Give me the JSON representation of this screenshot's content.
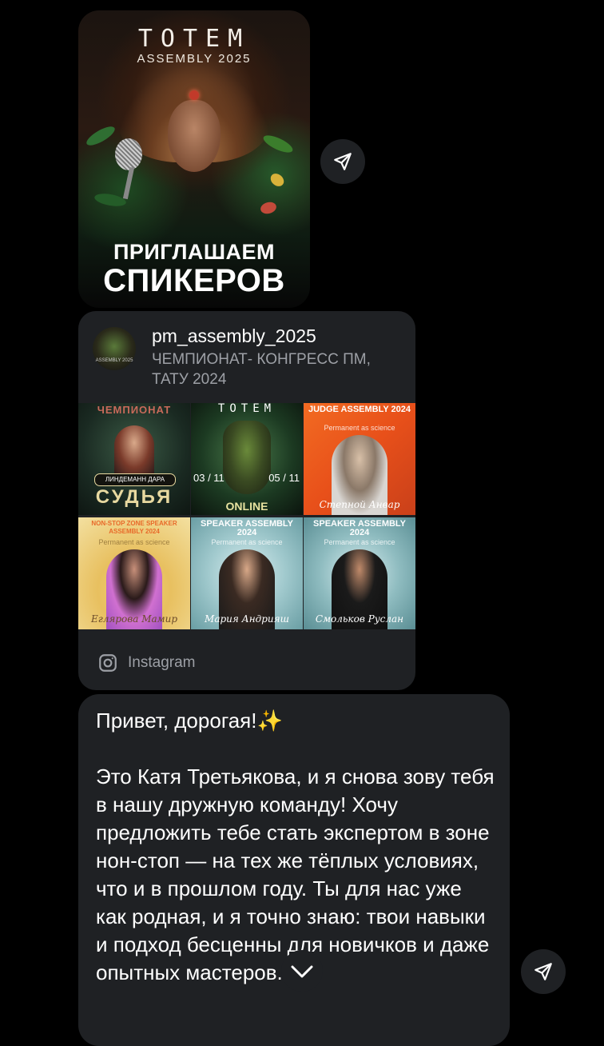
{
  "story_poster": {
    "brand": "TOTEM",
    "subtitle": "ASSEMBLY 2025",
    "cta_line1": "ПРИГЛАШАЕМ",
    "cta_line2": "СПИКЕРОВ"
  },
  "instagram_card": {
    "username": "pm_assembly_2025",
    "description": "ЧЕМПИОНАТ- КОНГРЕСС ПМ, ТАТУ 2024",
    "avatar_text": "ASSEMBLY 2025",
    "source_label": "Instagram",
    "tiles": [
      {
        "title": "ЧЕМПИОНАТ",
        "name": "ЛИНДЕМАНН ДАРА",
        "footer": "СУДЬЯ"
      },
      {
        "title": "TOTEM",
        "date_left": "03 / 11",
        "date_right": "05 / 11",
        "footer": "ONLINE"
      },
      {
        "title": "JUDGE ASSEMBLY 2024",
        "sub": "Permanent as science",
        "signature": "Степной Анвар"
      },
      {
        "title": "NON-STOP ZONE SPEAKER ASSEMBLY 2024",
        "sub": "Permanent as science",
        "signature": "Еглярова Мамир"
      },
      {
        "title": "SPEAKER ASSEMBLY 2024",
        "sub": "Permanent as science",
        "signature": "Мария Андрияш"
      },
      {
        "title": "SPEAKER ASSEMBLY 2024",
        "sub": "Permanent as science",
        "signature": "Смольков Руслан"
      }
    ]
  },
  "message": {
    "text": "Привет, дорогая!✨\n\nЭто Катя Третьякова, и я снова зову тебя в нашу дружную команду! Хочу предложить тебе стать экспертом в зоне нон-стоп — на тех же тёплых условиях, что и в прошлом году. Ты для нас уже как родная, и я точно знаю: твои навыки и подход бесценны для новичков и даже опытных мастеров."
  },
  "colors": {
    "background": "#000000",
    "bubble": "#1f2124",
    "muted_text": "#9da0a6"
  },
  "icons": [
    "share-icon",
    "instagram-icon",
    "chevron-down-icon"
  ]
}
